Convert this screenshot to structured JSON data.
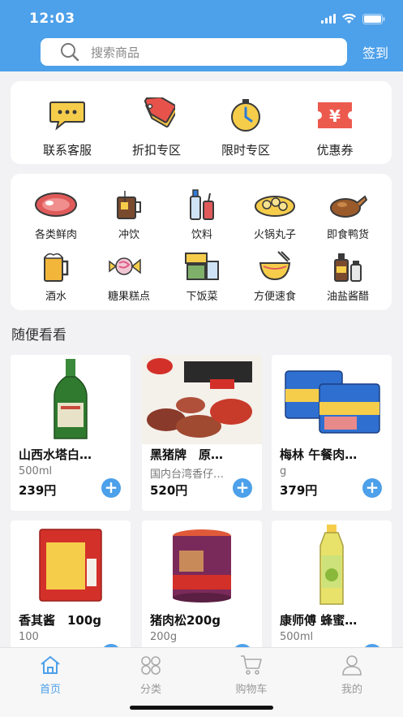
{
  "status_bar": {
    "time": "12:03"
  },
  "search": {
    "placeholder": "搜索商品"
  },
  "header": {
    "sign_in": "签到"
  },
  "quick_links": [
    {
      "label": "联系客服",
      "icon": "chat-bubble-icon"
    },
    {
      "label": "折扣专区",
      "icon": "price-tag-icon"
    },
    {
      "label": "限时专区",
      "icon": "stopwatch-icon"
    },
    {
      "label": "优惠券",
      "icon": "coupon-icon"
    }
  ],
  "categories": [
    {
      "label": "各类鲜肉",
      "icon": "meat-icon"
    },
    {
      "label": "冲饮",
      "icon": "hot-drink-icon"
    },
    {
      "label": "饮料",
      "icon": "bottled-drinks-icon"
    },
    {
      "label": "火锅丸子",
      "icon": "hotpot-balls-icon"
    },
    {
      "label": "即食鸭货",
      "icon": "roast-duck-icon"
    },
    {
      "label": "酒水",
      "icon": "beer-icon"
    },
    {
      "label": "糖果糕点",
      "icon": "candy-icon"
    },
    {
      "label": "下饭菜",
      "icon": "side-dish-icon"
    },
    {
      "label": "方便速食",
      "icon": "noodle-bowl-icon"
    },
    {
      "label": "油盐酱醋",
      "icon": "condiments-icon"
    }
  ],
  "section": {
    "title": "随便看看"
  },
  "products": [
    {
      "name": "山西水塔白…",
      "spec": "500ml",
      "price": "239円"
    },
    {
      "name": "黑猪牌　原…",
      "spec": "国内台湾香仔…",
      "price": "520円"
    },
    {
      "name": "梅林 午餐肉…",
      "spec": "g",
      "price": "379円"
    },
    {
      "name": "香其酱　100g",
      "spec": "100",
      "price": ""
    },
    {
      "name": "猪肉松200g",
      "spec": "200g",
      "price": ""
    },
    {
      "name": "康师傅 蜂蜜…",
      "spec": "500ml",
      "price": ""
    }
  ],
  "product_add_symbol": "+",
  "tabbar": [
    {
      "label": "首页",
      "active": true
    },
    {
      "label": "分类",
      "active": false
    },
    {
      "label": "购物车",
      "active": false
    },
    {
      "label": "我的",
      "active": false
    }
  ],
  "colors": {
    "brand_blue": "#4da0ea",
    "background": "#f2f2f4"
  }
}
